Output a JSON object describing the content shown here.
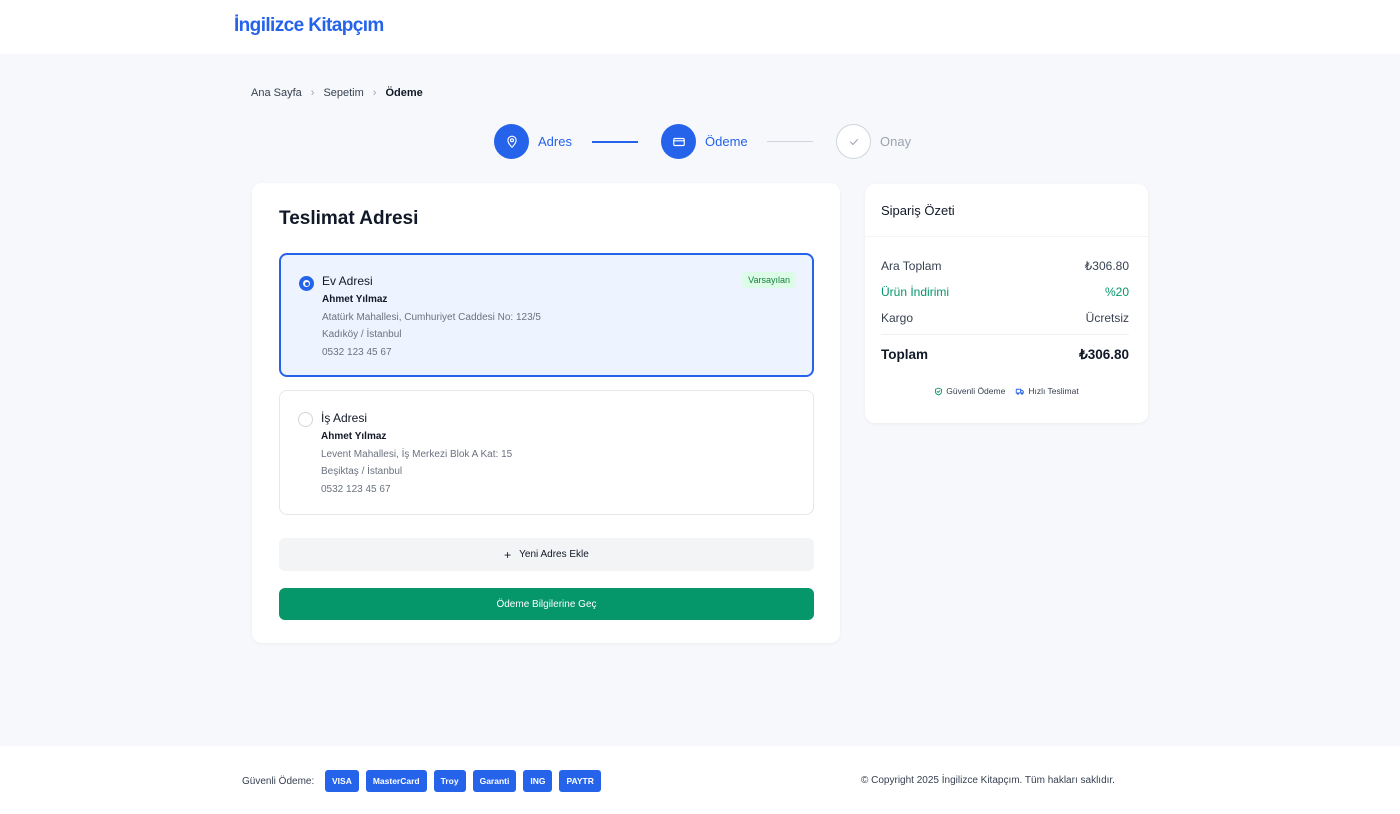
{
  "header": {
    "logo": "İngilizce Kitapçım"
  },
  "breadcrumb": {
    "items": [
      "Ana Sayfa",
      "Sepetim",
      "Ödeme"
    ]
  },
  "stepper": {
    "steps": [
      {
        "label": "Adres",
        "state": "active",
        "icon": "map-pin-icon"
      },
      {
        "label": "Ödeme",
        "state": "active",
        "icon": "credit-card-icon"
      },
      {
        "label": "Onay",
        "state": "inactive",
        "icon": "check-icon"
      }
    ]
  },
  "delivery": {
    "title": "Teslimat Adresi",
    "addresses": [
      {
        "title": "Ev Adresi",
        "badge": "Varsayılan",
        "name": "Ahmet Yılmaz",
        "line1": "Atatürk Mahallesi, Cumhuriyet Caddesi No: 123/5",
        "line2": "Kadıköy / İstanbul",
        "phone": "0532 123 45 67",
        "selected": true
      },
      {
        "title": "İş Adresi",
        "name": "Ahmet Yılmaz",
        "line1": "Levent Mahallesi, İş Merkezi Blok A Kat: 15",
        "line2": "Beşiktaş / İstanbul",
        "phone": "0532 123 45 67",
        "selected": false
      }
    ],
    "add_button": "Yeni Adres Ekle",
    "continue_button": "Ödeme Bilgilerine Geç"
  },
  "summary": {
    "title": "Sipariş Özeti",
    "subtotal_label": "Ara Toplam",
    "subtotal_value": "₺306.80",
    "discount_label": "Ürün İndirimi",
    "discount_value": "%20",
    "shipping_label": "Kargo",
    "shipping_value": "Ücretsiz",
    "total_label": "Toplam",
    "total_value": "₺306.80",
    "trust": [
      "Güvenli Ödeme",
      "Hızlı Teslimat"
    ]
  },
  "footer": {
    "payment_label": "Güvenli Ödeme:",
    "payment_methods": [
      "VISA",
      "MasterCard",
      "Troy",
      "Garanti",
      "ING",
      "PAYTR"
    ],
    "copyright": "© Copyright 2025 İngilizce Kitapçım. Tüm hakları saklıdır."
  },
  "colors": {
    "primary": "#2563eb",
    "success": "#059669",
    "background": "#f6f8fb",
    "selected_bg": "#eef4ff"
  }
}
